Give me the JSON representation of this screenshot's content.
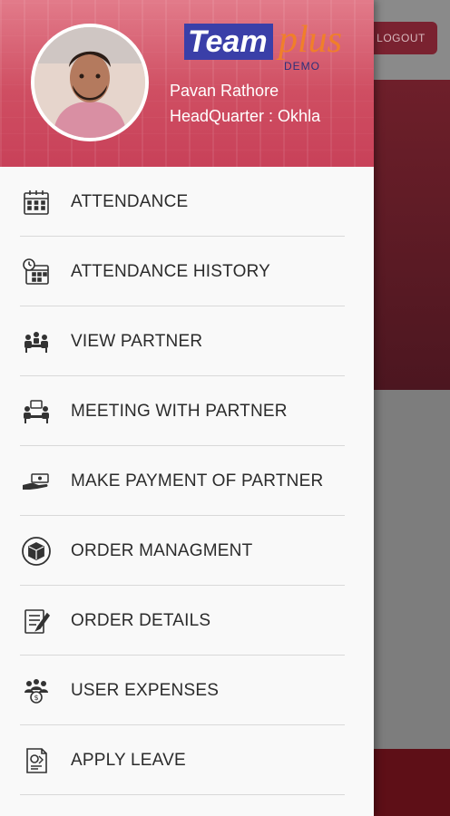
{
  "background": {
    "logout_label": "LOGOUT"
  },
  "drawer": {
    "brand": {
      "team": "Team",
      "plus": "plus",
      "demo": "DEMO"
    },
    "user": {
      "name": "Pavan Rathore",
      "headquarter": "HeadQuarter : Okhla"
    },
    "menu": [
      {
        "label": "ATTENDANCE",
        "icon": "calendar-icon"
      },
      {
        "label": "ATTENDANCE HISTORY",
        "icon": "clock-calendar-icon"
      },
      {
        "label": "VIEW PARTNER",
        "icon": "partners-meeting-icon"
      },
      {
        "label": "MEETING WITH PARTNER",
        "icon": "meeting-icon"
      },
      {
        "label": "MAKE PAYMENT OF PARTNER",
        "icon": "payment-hand-icon"
      },
      {
        "label": "ORDER MANAGMENT",
        "icon": "box-icon"
      },
      {
        "label": "ORDER DETAILS",
        "icon": "document-pen-icon"
      },
      {
        "label": "USER EXPENSES",
        "icon": "group-money-icon"
      },
      {
        "label": "APPLY LEAVE",
        "icon": "leave-form-icon"
      }
    ]
  },
  "colors": {
    "header_red": "#cf4e62",
    "brand_blue": "#3a3fa8",
    "brand_orange": "#f07f2a",
    "logout_bg": "#7a2230"
  }
}
